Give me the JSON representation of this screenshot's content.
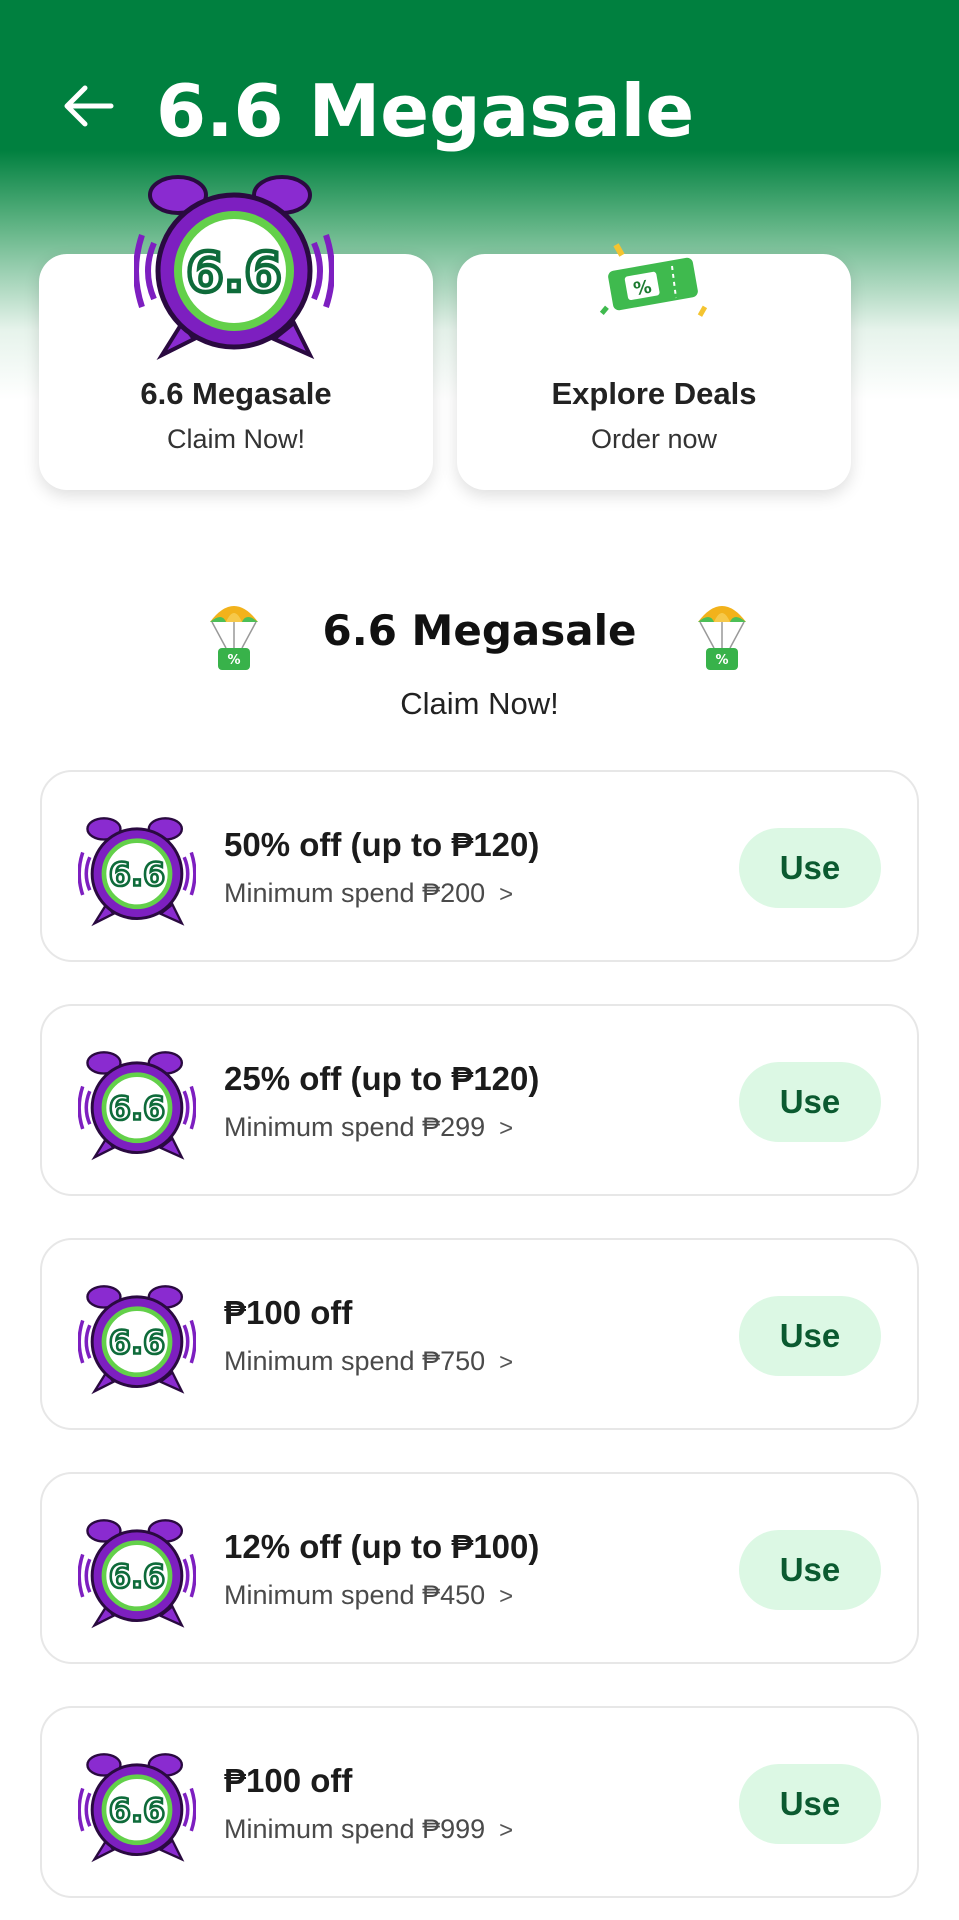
{
  "header": {
    "title": "6.6 Megasale",
    "back_icon": "arrow-left-icon"
  },
  "top_cards": [
    {
      "title": "6.6 Megasale",
      "subtitle": "Claim Now!",
      "icon": "alarm-clock-6-6-icon"
    },
    {
      "title": "Explore Deals",
      "subtitle": "Order now",
      "icon": "discount-ticket-icon"
    }
  ],
  "section": {
    "title": "6.6 Megasale",
    "subtitle": "Claim Now!",
    "decor_icon": "parachute-voucher-icon"
  },
  "vouchers": [
    {
      "title": "50% off (up to ₱120)",
      "min_spend": "Minimum spend ₱200",
      "button": "Use"
    },
    {
      "title": "25% off (up to ₱120)",
      "min_spend": "Minimum spend ₱299",
      "button": "Use"
    },
    {
      "title": "₱100 off",
      "min_spend": "Minimum spend ₱750",
      "button": "Use"
    },
    {
      "title": "12% off (up to ₱100)",
      "min_spend": "Minimum spend ₱450",
      "button": "Use"
    },
    {
      "title": "₱100 off",
      "min_spend": "Minimum spend ₱999",
      "button": "Use"
    }
  ],
  "colors": {
    "brand_green": "#00803f",
    "use_button_bg": "#dcf8e4",
    "use_button_text": "#0b5a30",
    "clock_purple": "#7d1fc0"
  }
}
